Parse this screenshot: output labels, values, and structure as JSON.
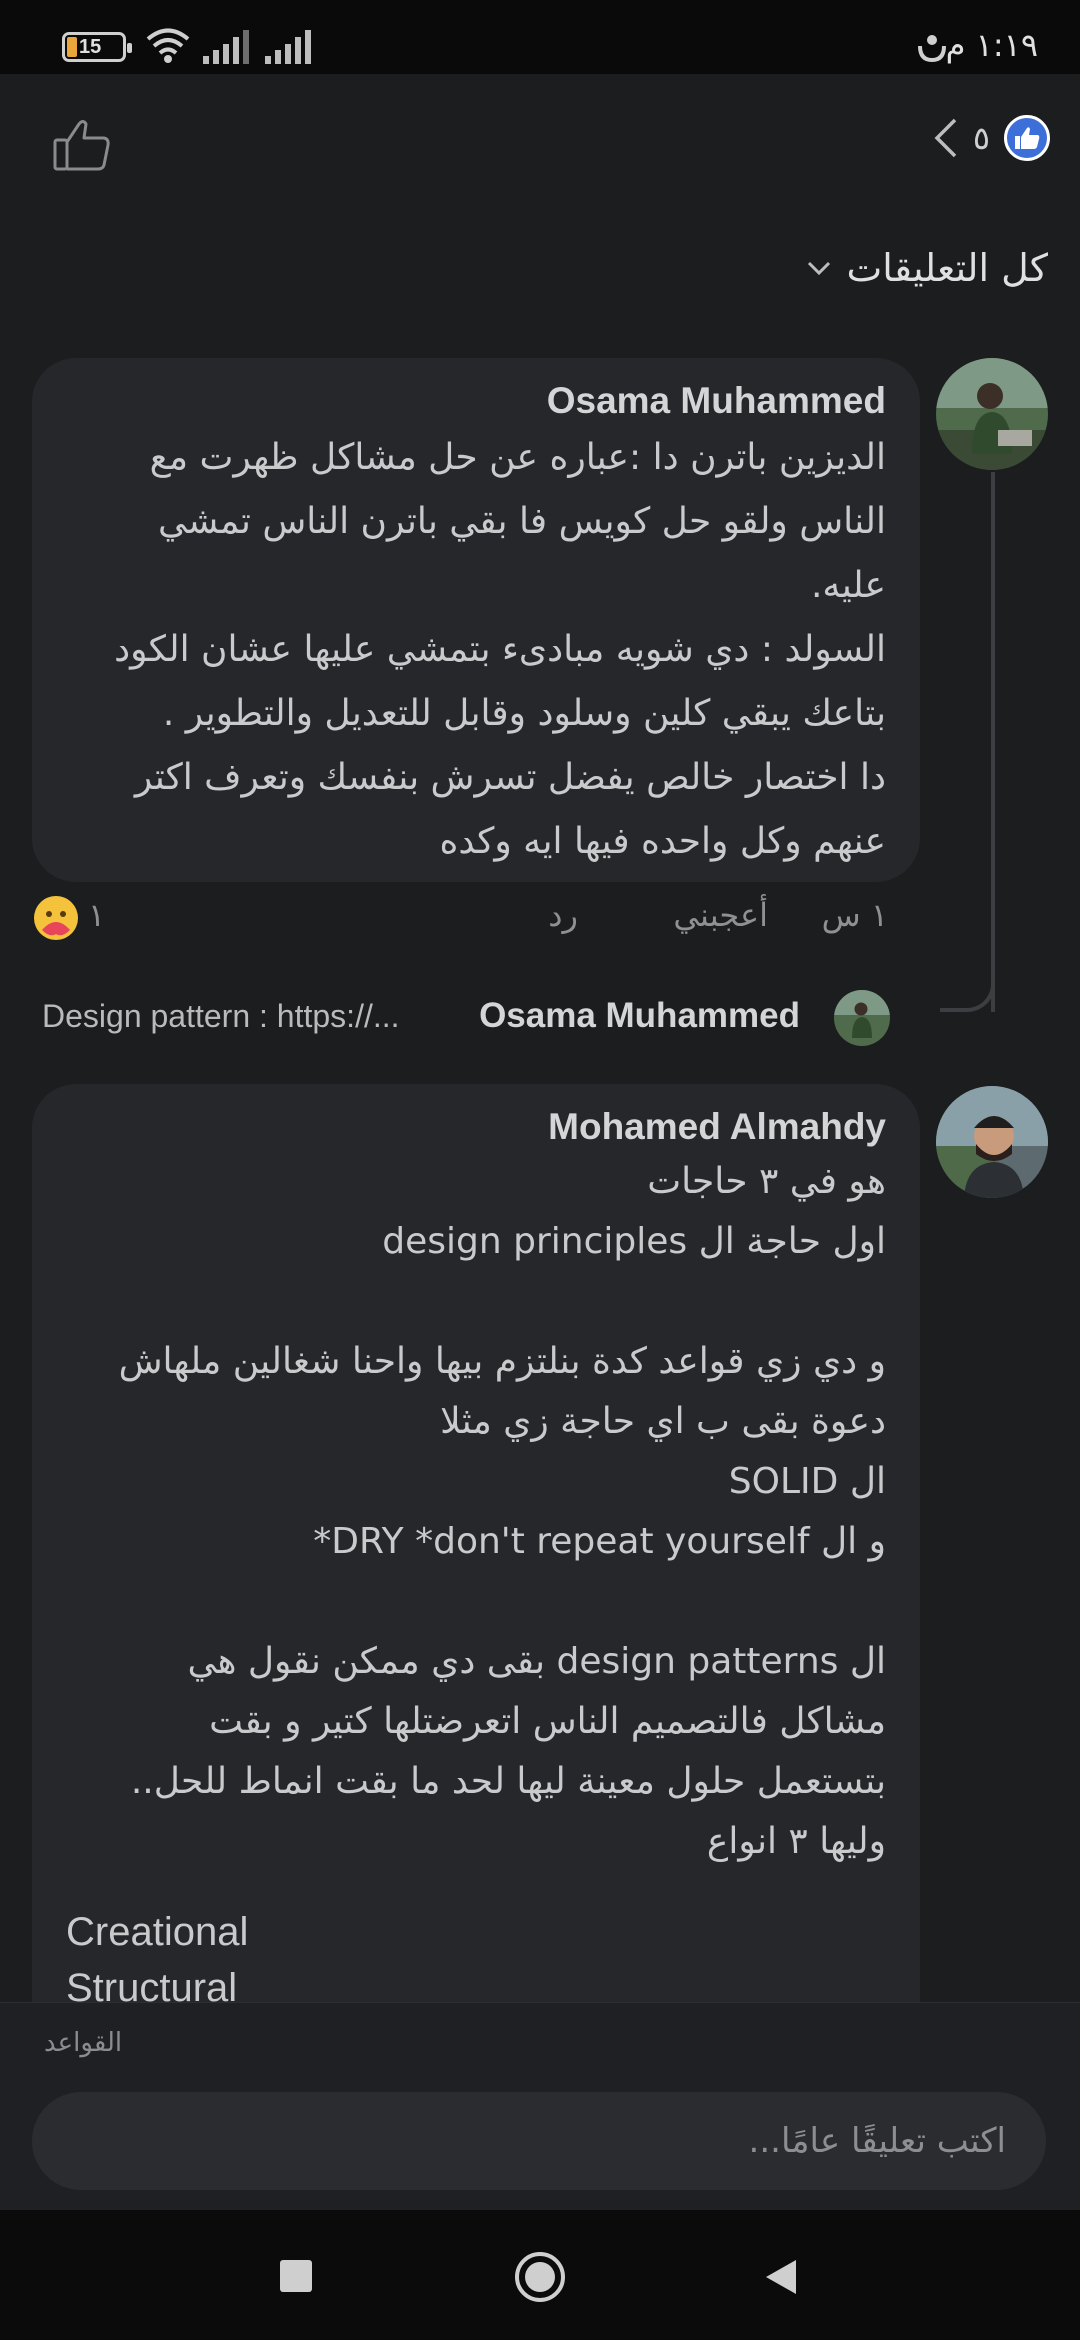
{
  "status_bar": {
    "battery": "15",
    "time": "١:١٩ م"
  },
  "header": {
    "reaction_count": "٥",
    "filter_label": "كل التعليقات"
  },
  "comments": [
    {
      "author": "Osama Muhammed",
      "body": "الديزين باترن دا :عباره عن حل مشاكل ظهرت مع\nالناس ولقو حل كويس فا بقي باترن الناس تمشي\nعليه.\nالسولد : دي شويه مبادىء بتمشي عليها عشان الكود\nبتاعك يبقي كلين وسلود وقابل للتعديل والتطوير .\nدا اختصار خالص يفضل تسرش بنفسك وتعرف اكتر\nعنهم وكل واحده فيها ايه وكده",
      "time": "١ س",
      "like_label": "أعجبني",
      "reply_label": "رد",
      "reaction_count": "١",
      "reply_preview": {
        "author": "Osama Muhammed",
        "text": "Design pattern : https://..."
      }
    },
    {
      "author": "Mohamed Almahdy",
      "body": "هو في ٣ حاجات\nاول حاجة ال design principles\n\nو دي زي قواعد كدة بنلتزم بيها واحنا شغالين ملهاش\nدعوة بقى ب اي حاجة زي مثلا\nال SOLID\nو ال DRY *don't repeat yourself*\n\nال design patterns بقى دي ممكن نقول هي\nمشاكل فالتصميم الناس اتعرضتلها كتير و بقت\nبتستعمل حلول معينة ليها لحد ما بقت انماط للحل..\nوليها ٣ انواع",
      "list_items": [
        "Creational",
        "Structural"
      ]
    }
  ],
  "composer": {
    "rules_label": "القواعد",
    "placeholder": "اكتب تعليقًا عامًا..."
  },
  "icons": {
    "thumb": "thumb-up-outline-icon",
    "like_badge": "like-badge-icon",
    "back": "chevron-left-icon",
    "dropdown": "chevron-down-icon",
    "care": "care-reaction-icon"
  },
  "colors": {
    "like_blue": "#3d6fd8",
    "care_yellow": "#f5c33b"
  }
}
